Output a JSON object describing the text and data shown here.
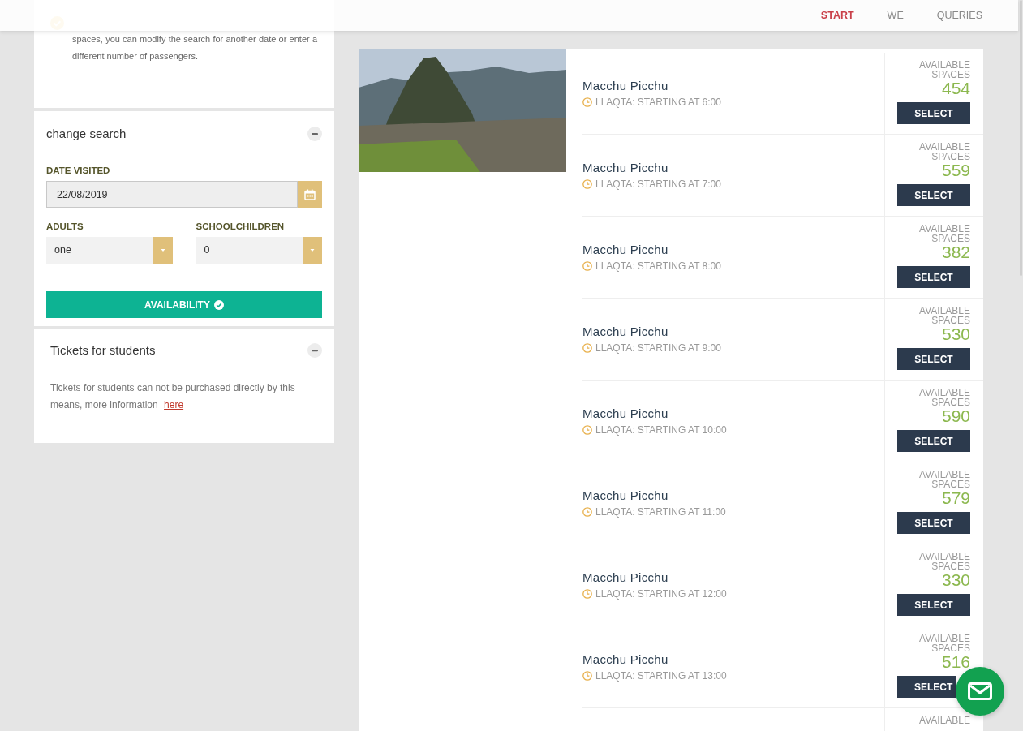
{
  "header": {
    "nav": [
      {
        "label": "START",
        "selected": true
      },
      {
        "label": "WE",
        "selected": false
      },
      {
        "label": "QUERIES",
        "selected": false
      }
    ]
  },
  "notice": {
    "text": "spaces, you can modify the search for another date or enter a different number of passengers."
  },
  "search_panel": {
    "title": "change search",
    "expanded": true,
    "date_label": "DATE VISITED",
    "date_value": "22/08/2019",
    "adults_label": "ADULTS",
    "adults_value": "one",
    "children_label": "SCHOOLCHILDREN",
    "children_value": "0",
    "button": "AVAILABILITY"
  },
  "students_panel": {
    "title": "Tickets for students",
    "expanded": true,
    "text": "Tickets for students can not be purchased directly by this means, more information",
    "link": "here"
  },
  "tours": [
    {
      "title": "Macchu Picchu",
      "subtitle": "LLAQTA: STARTING AT 6:00",
      "availability_label": "AVAILABLE SPACES",
      "spaces": "454",
      "button": "SELECT"
    },
    {
      "title": "Macchu Picchu",
      "subtitle": "LLAQTA: STARTING AT 7:00",
      "availability_label": "AVAILABLE SPACES",
      "spaces": "559",
      "button": "SELECT"
    },
    {
      "title": "Macchu Picchu",
      "subtitle": "LLAQTA: STARTING AT 8:00",
      "availability_label": "AVAILABLE SPACES",
      "spaces": "382",
      "button": "SELECT"
    },
    {
      "title": "Macchu Picchu",
      "subtitle": "LLAQTA: STARTING AT 9:00",
      "availability_label": "AVAILABLE SPACES",
      "spaces": "530",
      "button": "SELECT"
    },
    {
      "title": "Macchu Picchu",
      "subtitle": "LLAQTA: STARTING AT 10:00",
      "availability_label": "AVAILABLE SPACES",
      "spaces": "590",
      "button": "SELECT"
    },
    {
      "title": "Macchu Picchu",
      "subtitle": "LLAQTA: STARTING AT 11:00",
      "availability_label": "AVAILABLE SPACES",
      "spaces": "579",
      "button": "SELECT"
    },
    {
      "title": "Macchu Picchu",
      "subtitle": "LLAQTA: STARTING AT 12:00",
      "availability_label": "AVAILABLE SPACES",
      "spaces": "330",
      "button": "SELECT"
    },
    {
      "title": "Macchu Picchu",
      "subtitle": "LLAQTA: STARTING AT 13:00",
      "availability_label": "AVAILABLE SPACES",
      "spaces": "516",
      "button": "SELECT"
    },
    {
      "availability_label": "AVAILABLE"
    }
  ]
}
